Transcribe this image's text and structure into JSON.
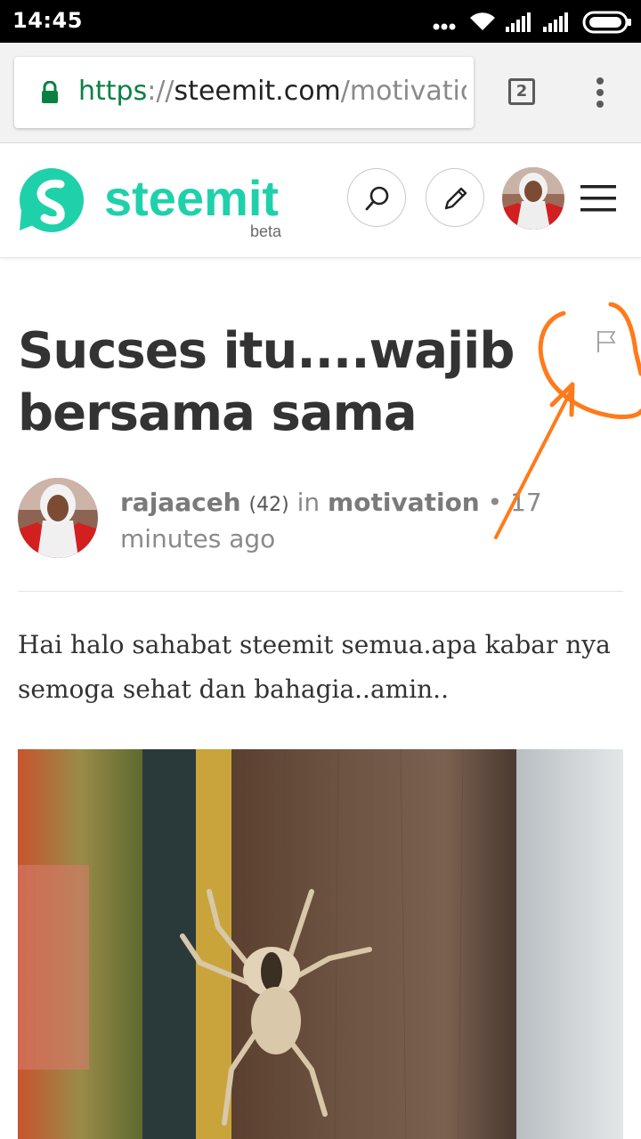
{
  "status_bar": {
    "time": "14:45",
    "icons": [
      "more-dots-icon",
      "wifi-icon",
      "signal-icon",
      "signal-icon",
      "battery-icon"
    ]
  },
  "browser": {
    "url": {
      "scheme": "https",
      "separator": "://",
      "host": "steemit.com",
      "path": "/motivatio"
    },
    "tab_count": "2"
  },
  "site_header": {
    "brand": "steemit",
    "badge": "beta",
    "icons": [
      "search-icon",
      "pencil-icon",
      "avatar",
      "hamburger-icon"
    ]
  },
  "post": {
    "title": "Sucses itu....wajib bersama sama",
    "author": "rajaaceh",
    "reputation": "(42)",
    "in_label": "in",
    "category": "motivation",
    "bullet": "•",
    "time_ago": "17 minutes ago",
    "body": "Hai halo sahabat steemit semua.apa kabar nya semoga sehat dan bahagia..amin.."
  },
  "colors": {
    "brand": "#1fd1ab",
    "secure_scheme": "#0b8043",
    "annotation": "#ff7a1a"
  }
}
